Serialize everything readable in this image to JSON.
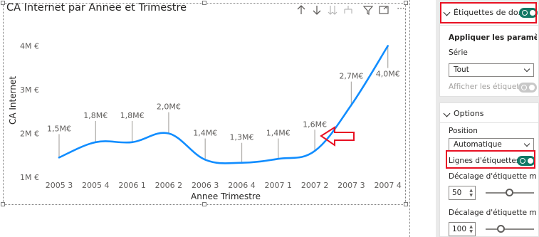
{
  "visual": {
    "title": "CA Internet par Annee et Trimestre",
    "toolbar": [
      "arrow-up-icon",
      "arrow-down-icon",
      "double-arrow-down-icon",
      "expand-hierarchy-icon",
      "filter-icon",
      "focus-mode-icon",
      "more-options-icon"
    ],
    "more_label": "···"
  },
  "chart_data": {
    "type": "line",
    "title": "CA Internet par Annee et Trimestre",
    "xlabel": "Annee Trimestre",
    "ylabel": "CA Internet",
    "categories": [
      "2005 3",
      "2005 4",
      "2006 1",
      "2006 2",
      "2006 3",
      "2006 4",
      "2007 1",
      "2007 2",
      "2007 3",
      "2007 4"
    ],
    "series": [
      {
        "values": [
          1.45,
          1.8,
          1.8,
          2.0,
          1.4,
          1.33,
          1.42,
          1.6,
          2.65,
          4.0
        ],
        "color": "#118dff"
      }
    ],
    "data_labels": [
      "1,5M€",
      "1,8M€",
      "1,8M€",
      "2,0M€",
      "1,4M€",
      "1,3M€",
      "1,4M€",
      "1,6M€",
      "2,7M€",
      "4,0M€"
    ],
    "label_heights": [
      1.5,
      1.8,
      1.8,
      2.0,
      1.4,
      1.3,
      1.4,
      1.6,
      2.7,
      4.0
    ],
    "yticks": [
      {
        "value": 1,
        "label": "1M €"
      },
      {
        "value": 2,
        "label": "2M €"
      },
      {
        "value": 3,
        "label": "3M €"
      },
      {
        "value": 4,
        "label": "4M €"
      }
    ],
    "ylim": [
      0.8,
      4.3
    ],
    "grid": false,
    "legend": "none",
    "line_color": "#118dff",
    "leader_line_color": "#b3b0ad",
    "annotation": {
      "type": "arrow",
      "color": "#e81123",
      "points_to": "2007 2"
    }
  },
  "pane": {
    "data_labels_card": {
      "header": "Étiquettes de do...",
      "toggle_on": true,
      "apply_title": "Appliquer les paramètre...",
      "series_label": "Série",
      "series_value": "Tout",
      "show_labels_label": "Afficher les étiquet...",
      "show_labels_toggle": "disabled"
    },
    "options_card": {
      "header": "Options",
      "position_label": "Position",
      "position_value": "Automatique",
      "leader_lines_label": "Lignes d'étiquettes",
      "leader_lines_on": true,
      "min_offset_label": "Décalage d'étiquette min...",
      "min_offset_value": "50",
      "min_offset_fraction": 0.5,
      "max_offset_label": "Décalage d'étiquette max...",
      "max_offset_value": "100",
      "max_offset_fraction": 0.33
    },
    "highlight_color": "#e81123",
    "toggle_color": "#117865"
  }
}
